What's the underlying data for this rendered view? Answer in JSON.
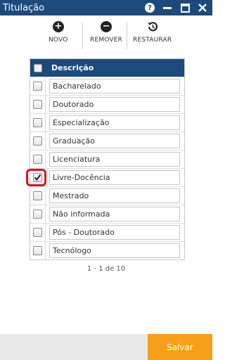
{
  "window": {
    "title": "Titulação",
    "help_glyph": "?"
  },
  "toolbar": {
    "novo_label": "NOVO",
    "remover_label": "REMOVER",
    "restaurar_label": "RESTAURAR"
  },
  "grid": {
    "header": "Descrição",
    "rows": [
      {
        "label": "Bacharelado",
        "checked": false
      },
      {
        "label": "Doutorado",
        "checked": false
      },
      {
        "label": "Especialização",
        "checked": false
      },
      {
        "label": "Graduação",
        "checked": false
      },
      {
        "label": "Licenciatura",
        "checked": false
      },
      {
        "label": "Livre-Docência",
        "checked": true
      },
      {
        "label": "Mestrado",
        "checked": false
      },
      {
        "label": "Não informada",
        "checked": false
      },
      {
        "label": "Pós - Doutorado",
        "checked": false
      },
      {
        "label": "Tecnólogo",
        "checked": false
      }
    ]
  },
  "pager": {
    "text": "1 - 1 de 10"
  },
  "footer": {
    "save_label": "Salvar"
  },
  "colors": {
    "titlebar": "#1d4a7c",
    "save_button": "#f6a01a",
    "highlight": "#e3111a"
  }
}
